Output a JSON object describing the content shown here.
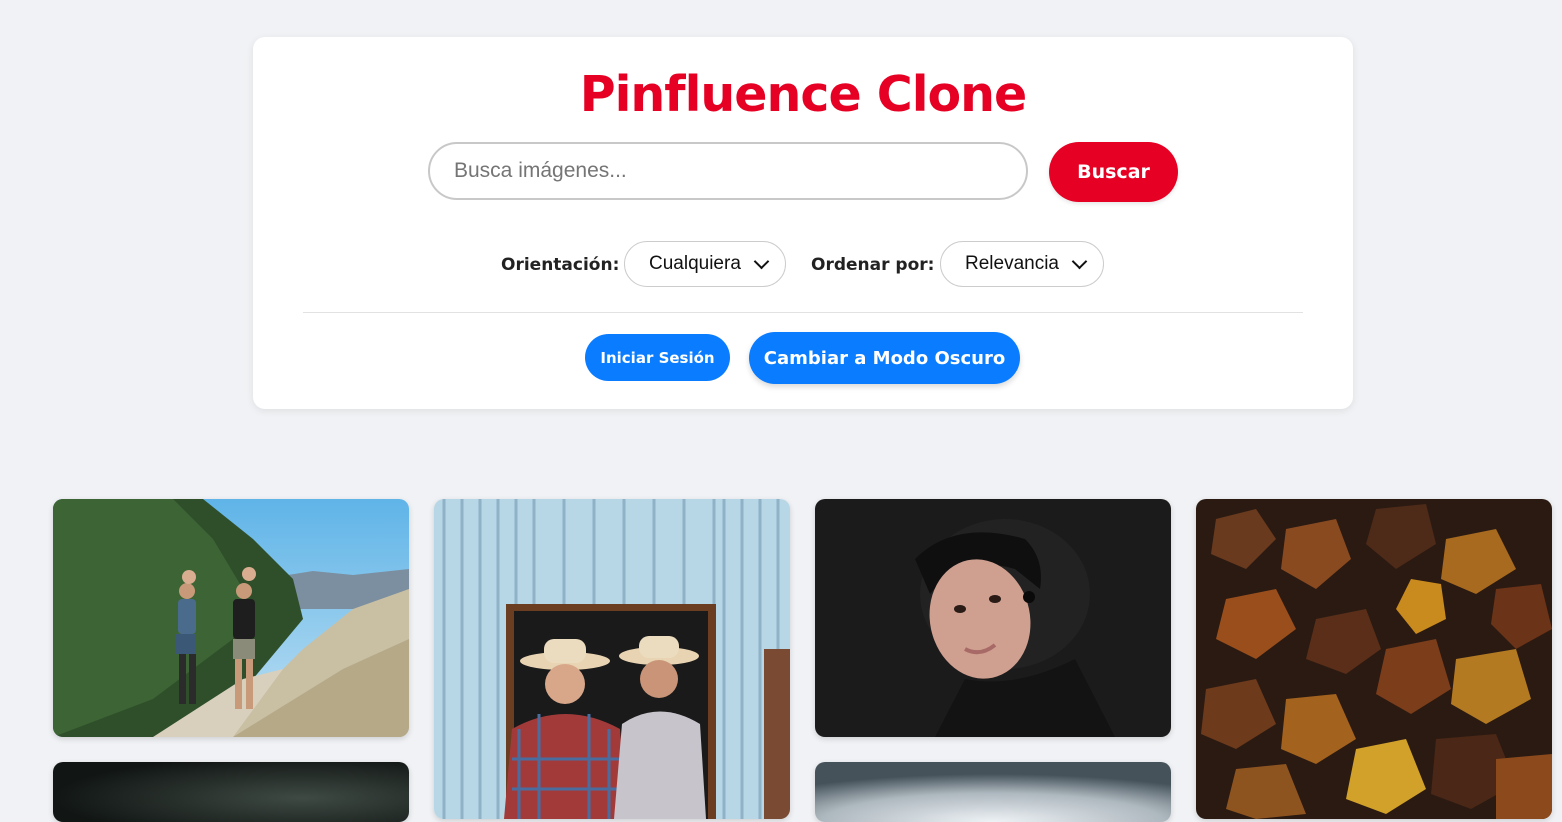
{
  "header": {
    "title": "Pinfluence Clone"
  },
  "search": {
    "placeholder": "Busca imágenes...",
    "value": "",
    "button_label": "Buscar"
  },
  "filters": {
    "orientation_label": "Orientación:",
    "orientation_selected": "Cualquiera",
    "sort_label": "Ordenar por:",
    "sort_selected": "Relevancia"
  },
  "actions": {
    "login_label": "Iniciar Sesión",
    "theme_toggle_label": "Cambiar a Modo Oscuro"
  },
  "colors": {
    "brand_red": "#e60023",
    "action_blue": "#0a7cff",
    "page_background": "#f0f2f5"
  },
  "icons": {
    "select_arrow": "chevron-down-icon"
  },
  "gallery": {
    "items": [
      {
        "subject": "family-hiking-photo"
      },
      {
        "subject": "two-men-cowboy-hats-photo"
      },
      {
        "subject": "woman-portrait-dark-photo"
      },
      {
        "subject": "autumn-leaves-photo"
      },
      {
        "subject": "dark-green-photo"
      },
      {
        "subject": "grey-vignette-photo"
      }
    ]
  }
}
